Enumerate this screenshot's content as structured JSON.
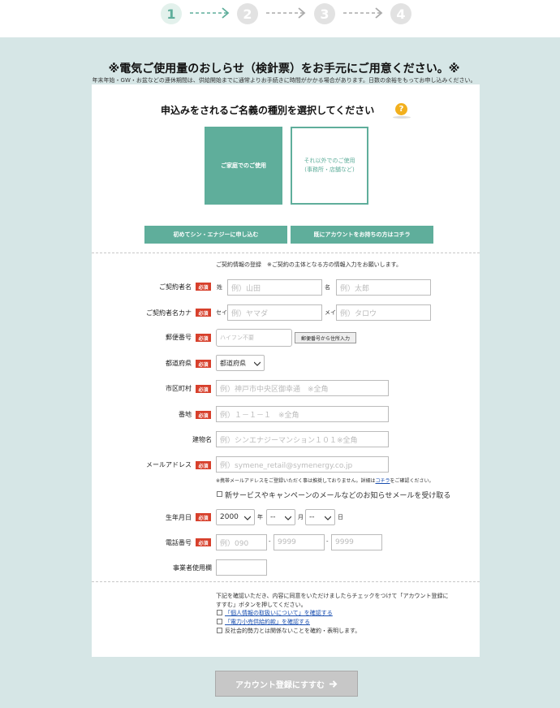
{
  "steps": [
    "1",
    "2",
    "3",
    "4"
  ],
  "notice": {
    "title": "※電気ご使用量のおしらせ（検針票）をお手元にご用意ください。※",
    "subtitle": "年末年始・GW・お盆などの連休期間は、供給開始までに通常よりお手続きに時間がかかる場合があります。日数の余裕をもってお申し込みください。"
  },
  "type_section": {
    "title": "申込みをされるご名義の種別を選択してください",
    "help_symbol": "?",
    "home_label": "ご家庭でのご使用",
    "other_line1": "それ以外でのご使用",
    "other_line2": "(事務所・店舗など)"
  },
  "tabs": {
    "new_label": "初めてシン・エナジーに申し込む",
    "existing_label": "既にアカウントをお持ちの方はコチラ"
  },
  "form": {
    "intro": "ご契約情報の登録　※ご契約の主体となる方の情報入力をお願いします。",
    "required_badge": "必須",
    "name": {
      "label": "ご契約者名",
      "last_prefix": "姓",
      "last_placeholder": "例）山田",
      "first_prefix": "名",
      "first_placeholder": "例）太郎"
    },
    "kana": {
      "label": "ご契約者名カナ",
      "last_prefix": "セイ",
      "last_placeholder": "例）ヤマダ",
      "first_prefix": "メイ",
      "first_placeholder": "例）タロウ"
    },
    "postal": {
      "label": "郵便番号",
      "placeholder": "ハイフン不要",
      "lookup_button": "郵便番号から住所入力"
    },
    "prefecture": {
      "label": "都道府県",
      "value": "都道府県"
    },
    "city": {
      "label": "市区町村",
      "placeholder": "例）神戸市中央区御幸通　※全角"
    },
    "address": {
      "label": "番地",
      "placeholder": "例）１－１－１　※全角"
    },
    "building": {
      "label": "建物名",
      "placeholder": "例）シンエナジーマンション１０１※全角"
    },
    "email": {
      "label": "メールアドレス",
      "placeholder": "例）symene_retail@symenergy.co.jp",
      "note_before": "※携帯メールアドレスをご登録いただく事は推奨しておりません。詳細は",
      "note_link": "コチラ",
      "note_after": "をご確認ください。",
      "opt_in": "新サービスやキャンペーンのメールなどのお知らせメールを受け取る"
    },
    "birth": {
      "label": "生年月日",
      "year": "2000",
      "year_suffix": "年",
      "month": "--",
      "month_suffix": "月",
      "day": "--",
      "day_suffix": "日"
    },
    "phone": {
      "label": "電話番号",
      "p1": "例）090",
      "p2": "9999",
      "p3": "9999",
      "sep": "-"
    },
    "business": {
      "label": "事業者使用欄"
    }
  },
  "agreement": {
    "text1": "下記を確認いただき、内容に同意をいただけましたらチェックをつけて「アカウント登録に",
    "text2": "すすむ」ボタンを押してください。",
    "privacy_link": "「個人情報の取扱いについて」を確認する",
    "supply_link": "「電力小売供給約款」を確認する",
    "antisocial": "反社会的勢力とは関係ないことを確約・表明します。"
  },
  "submit": {
    "label": "アカウント登録にすすむ"
  }
}
